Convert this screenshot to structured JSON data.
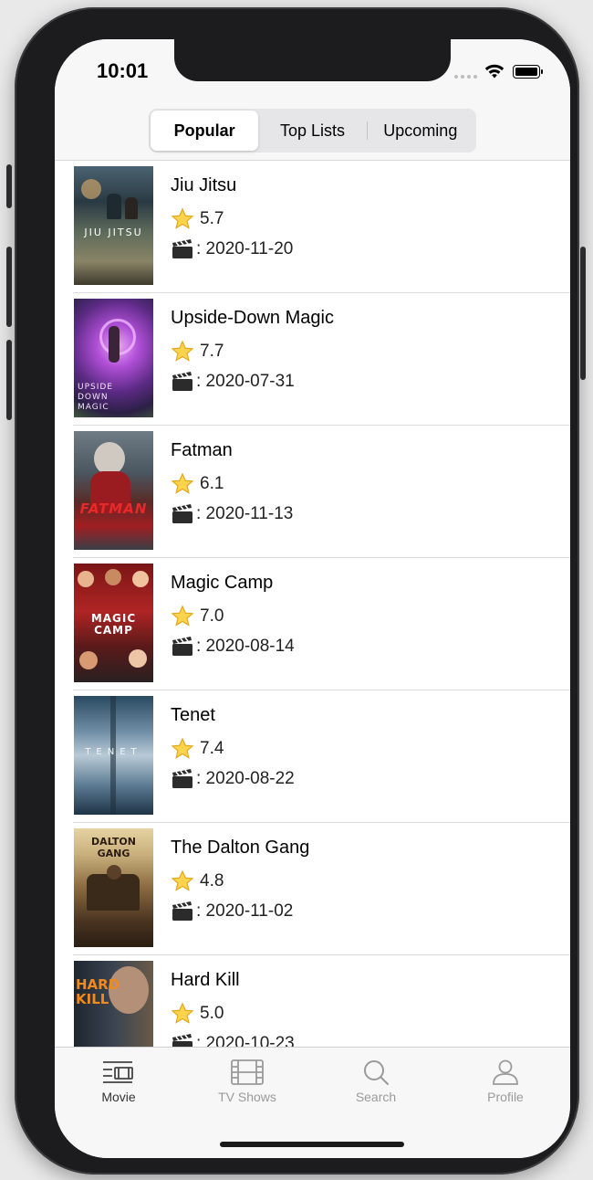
{
  "status": {
    "time": "10:01"
  },
  "segments": [
    {
      "label": "Popular",
      "active": true
    },
    {
      "label": "Top Lists",
      "active": false
    },
    {
      "label": "Upcoming",
      "active": false
    }
  ],
  "movies": [
    {
      "title": "Jiu Jitsu",
      "rating": "5.7",
      "date": ": 2020-11-20",
      "poster_text": "JIU JITSU"
    },
    {
      "title": "Upside-Down Magic",
      "rating": "7.7",
      "date": ": 2020-07-31",
      "poster_text": "UPSIDE DOWN MAGIC"
    },
    {
      "title": "Fatman",
      "rating": "6.1",
      "date": ": 2020-11-13",
      "poster_text": "FATMAN"
    },
    {
      "title": "Magic Camp",
      "rating": "7.0",
      "date": ": 2020-08-14",
      "poster_text": "MAGIC CAMP"
    },
    {
      "title": "Tenet",
      "rating": "7.4",
      "date": ": 2020-08-22",
      "poster_text": "TENET"
    },
    {
      "title": "The Dalton Gang",
      "rating": "4.8",
      "date": ": 2020-11-02",
      "poster_text": "DALTON GANG"
    },
    {
      "title": "Hard Kill",
      "rating": "5.0",
      "date": ": 2020-10-23",
      "poster_text": "HARD KILL"
    }
  ],
  "tabs": [
    {
      "label": "Movie",
      "icon": "movie-list-icon",
      "active": true
    },
    {
      "label": "TV Shows",
      "icon": "film-strip-icon",
      "active": false
    },
    {
      "label": "Search",
      "icon": "search-icon",
      "active": false
    },
    {
      "label": "Profile",
      "icon": "person-icon",
      "active": false
    }
  ],
  "colors": {
    "accent": "#000000",
    "tab_inactive": "#9a9a9a",
    "tab_active": "#333333"
  }
}
